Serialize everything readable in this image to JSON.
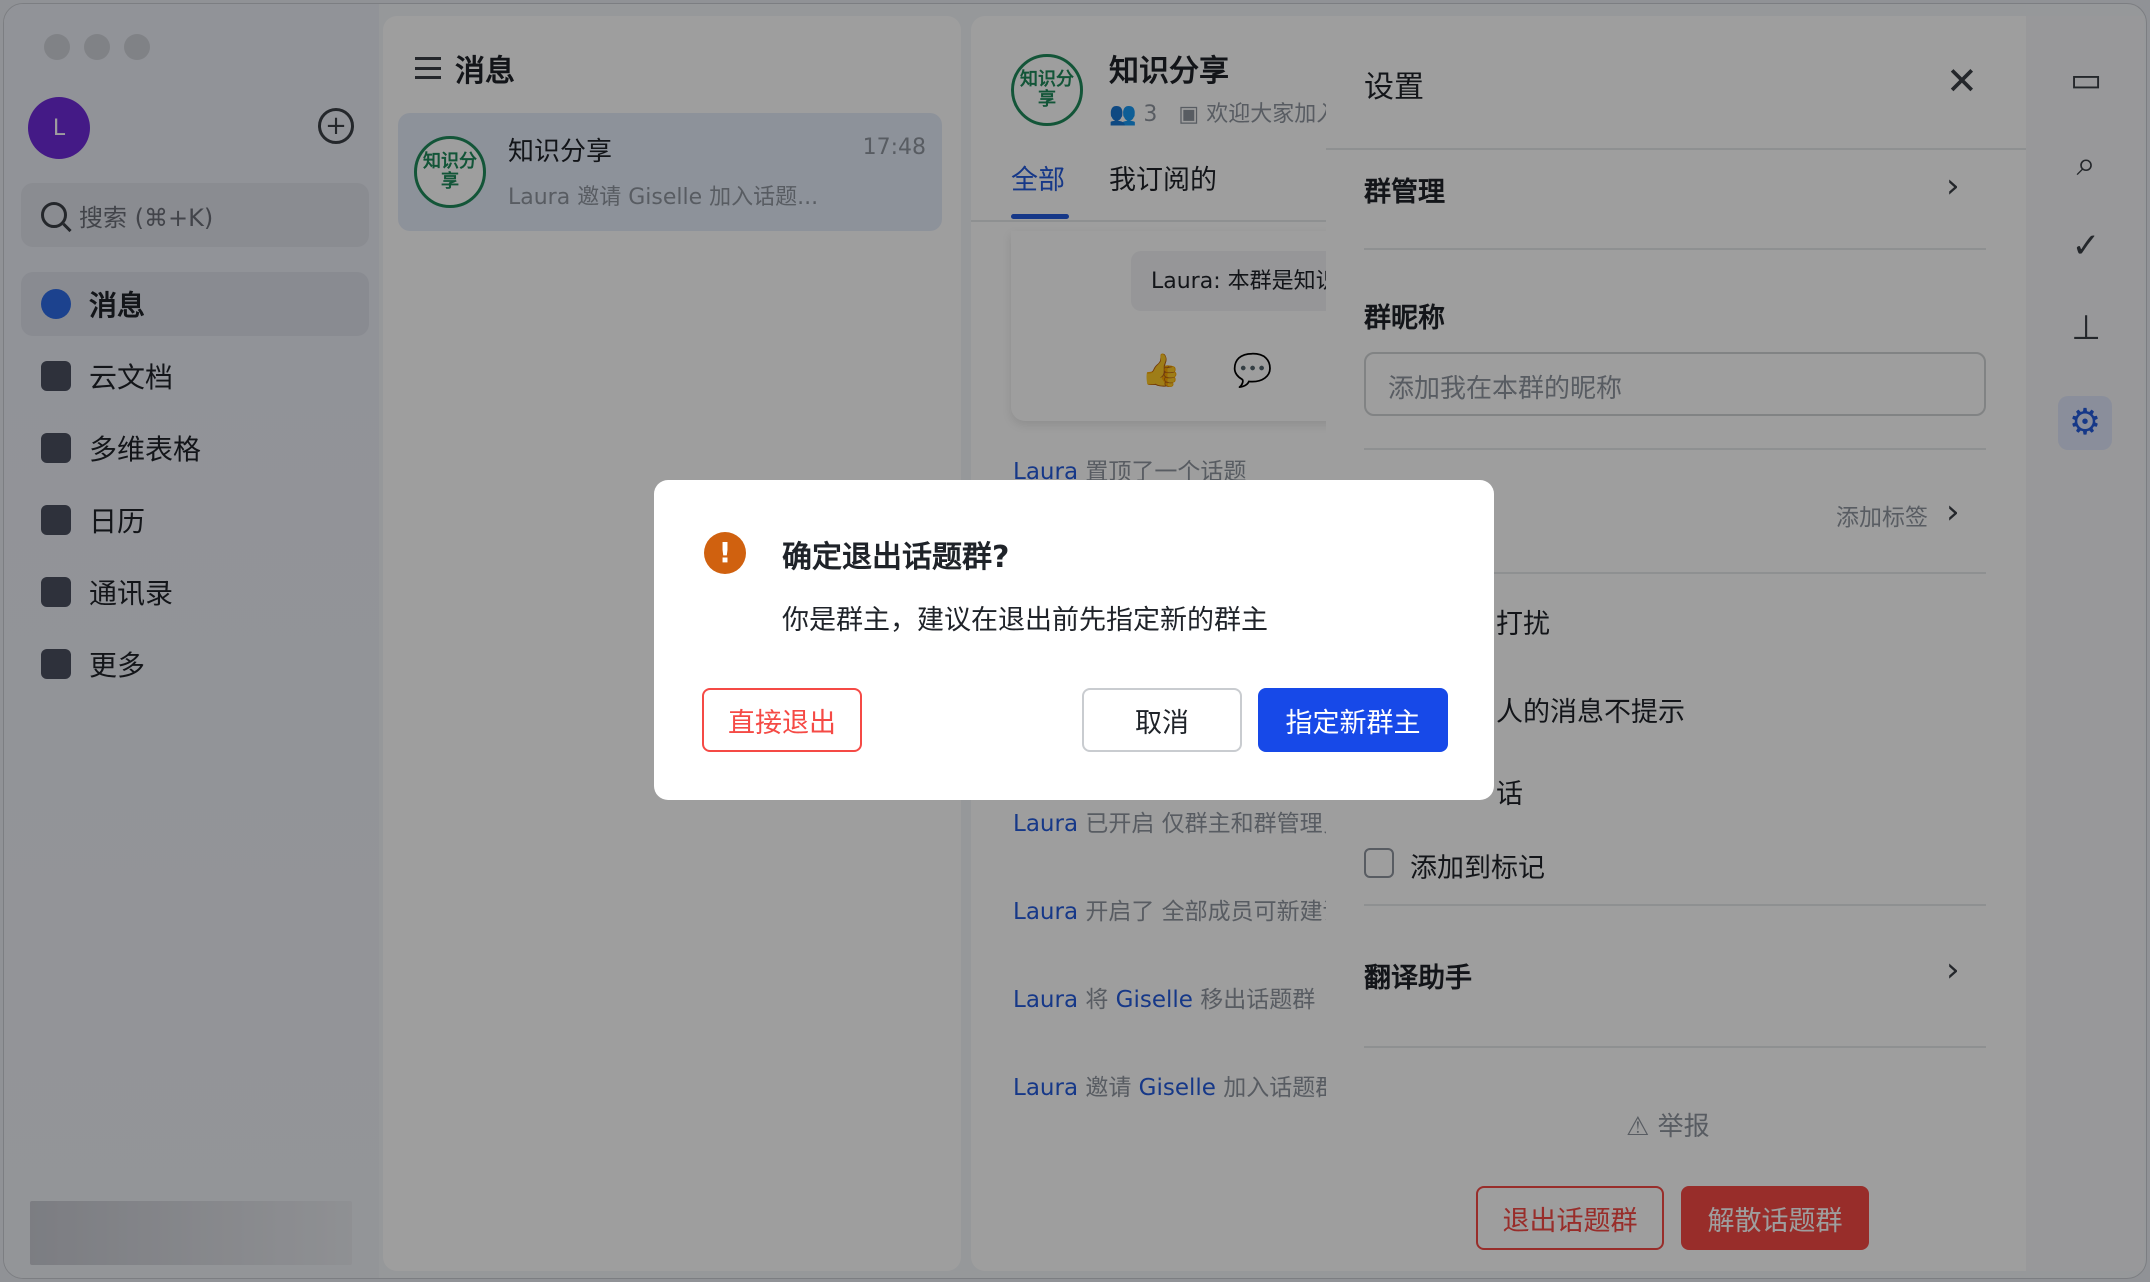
{
  "sidebar": {
    "avatar_letter": "L",
    "search_placeholder": "搜索 (⌘+K)",
    "items": [
      {
        "label": "消息",
        "icon": "message-icon"
      },
      {
        "label": "云文档",
        "icon": "cloud-doc-icon"
      },
      {
        "label": "多维表格",
        "icon": "base-table-icon"
      },
      {
        "label": "日历",
        "icon": "calendar-icon"
      },
      {
        "label": "通讯录",
        "icon": "contacts-icon"
      },
      {
        "label": "更多",
        "icon": "more-apps-icon"
      }
    ]
  },
  "chatlist": {
    "title": "消息",
    "items": [
      {
        "logo": "知识分享",
        "title": "知识分享",
        "time": "17:48",
        "preview": "Laura 邀请 Giselle 加入话题..."
      }
    ]
  },
  "chatview": {
    "logo": "知识分享",
    "title": "知识分享",
    "members": "3",
    "announcement": "欢迎大家加入",
    "tabs": [
      "全部",
      "我订阅的"
    ],
    "quote": "Laura: 本群是知识分享群",
    "system_messages": [
      {
        "user": "Laura",
        "text": "置顶了一个话题"
      },
      {
        "user": "Laura",
        "text": "已开启 仅群主和群管理员可添加成员"
      },
      {
        "user": "Laura",
        "text": "开启了 全部成员可新建话题"
      },
      {
        "user": "Laura",
        "text": "将",
        "target": "Giselle",
        "rest": "移出话题群"
      },
      {
        "user": "Laura",
        "text": "邀请",
        "target": "Giselle",
        "rest": "加入话题群"
      }
    ]
  },
  "settings": {
    "title": "设置",
    "group_manage": "群管理",
    "nickname_title": "群昵称",
    "nickname_placeholder": "添加我在本群的昵称",
    "add_tag": "添加标签",
    "dnd_suffix": "打扰",
    "mute_suffix": "人的消息不提示",
    "pin_suffix": "话",
    "add_to_marks": "添加到标记",
    "translate": "翻译助手",
    "report": "举报",
    "leave_btn": "退出话题群",
    "dissolve_btn": "解散话题群"
  },
  "dialog": {
    "title": "确定退出话题群?",
    "message": "你是群主，建议在退出前先指定新的群主",
    "quit_btn": "直接退出",
    "cancel_btn": "取消",
    "primary_btn": "指定新群主"
  },
  "colors": {
    "accent": "#245bdb",
    "primary_button": "#1749e8",
    "danger": "#f54a45",
    "warning": "#d0610f",
    "group_green": "#1f8a5b"
  }
}
